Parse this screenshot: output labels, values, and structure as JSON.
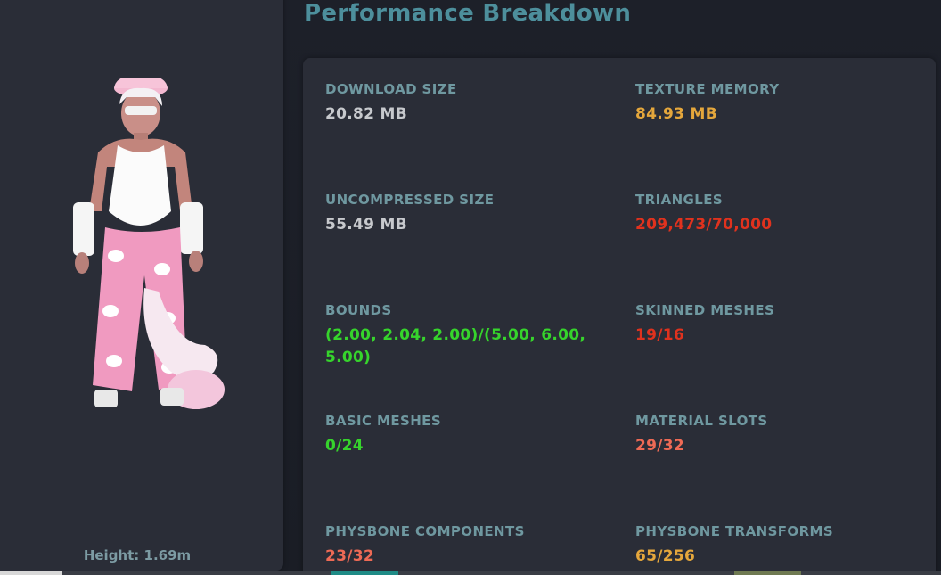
{
  "title": "Performance Breakdown",
  "avatar": {
    "height_label": "Height: 1.69m"
  },
  "stats": {
    "download_size": {
      "label": "DOWNLOAD SIZE",
      "value": "20.82 MB",
      "color": "#c7c9cd"
    },
    "texture_memory": {
      "label": "TEXTURE MEMORY",
      "value": "84.93 MB",
      "color": "#e5a73c"
    },
    "uncompressed_size": {
      "label": "UNCOMPRESSED SIZE",
      "value": "55.49 MB",
      "color": "#c7c9cd"
    },
    "triangles": {
      "label": "TRIANGLES",
      "value": "209,473/70,000",
      "color": "#e0321e"
    },
    "bounds": {
      "label": "BOUNDS",
      "value": "(2.00, 2.04, 2.00)/(5.00, 6.00, 5.00)",
      "color": "#36d42c"
    },
    "skinned_meshes": {
      "label": "SKINNED MESHES",
      "value": "19/16",
      "color": "#e0321e"
    },
    "basic_meshes": {
      "label": "BASIC MESHES",
      "value": "0/24",
      "color": "#36d42c"
    },
    "material_slots": {
      "label": "MATERIAL SLOTS",
      "value": "29/32",
      "color": "#ee6a55"
    },
    "physbone_components": {
      "label": "PHYSBONE COMPONENTS",
      "value": "23/32",
      "color": "#ee6a55"
    },
    "physbone_transforms": {
      "label": "PHYSBONE TRANSFORMS",
      "value": "65/256",
      "color": "#e5a73c"
    }
  }
}
